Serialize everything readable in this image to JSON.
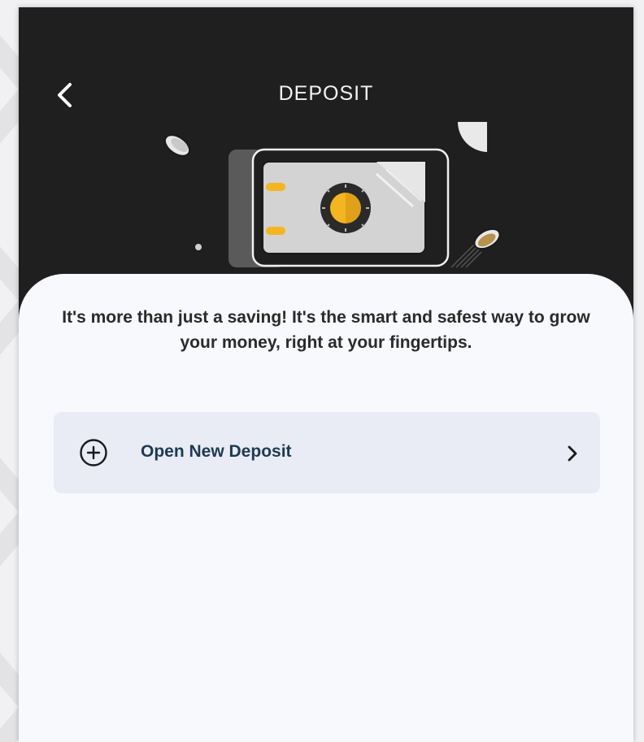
{
  "header": {
    "title": "DEPOSIT",
    "back_icon": "chevron-left-icon"
  },
  "illustration": {
    "name": "safe-vault-illustration",
    "accent_color": "#f4b51e"
  },
  "main": {
    "intro_text": "It's more than just a saving! It's the smart and safest way to grow your money, right at your fingertips.",
    "open_deposit": {
      "label": "Open New Deposit",
      "leading_icon": "plus-circle-icon",
      "trailing_icon": "chevron-right-icon"
    }
  },
  "colors": {
    "header_background": "#1f1f1f",
    "sheet_background": "#f8f9fc",
    "card_background": "#e9ebf5",
    "card_label": "#1d3b52",
    "accent": "#f4b51e"
  }
}
